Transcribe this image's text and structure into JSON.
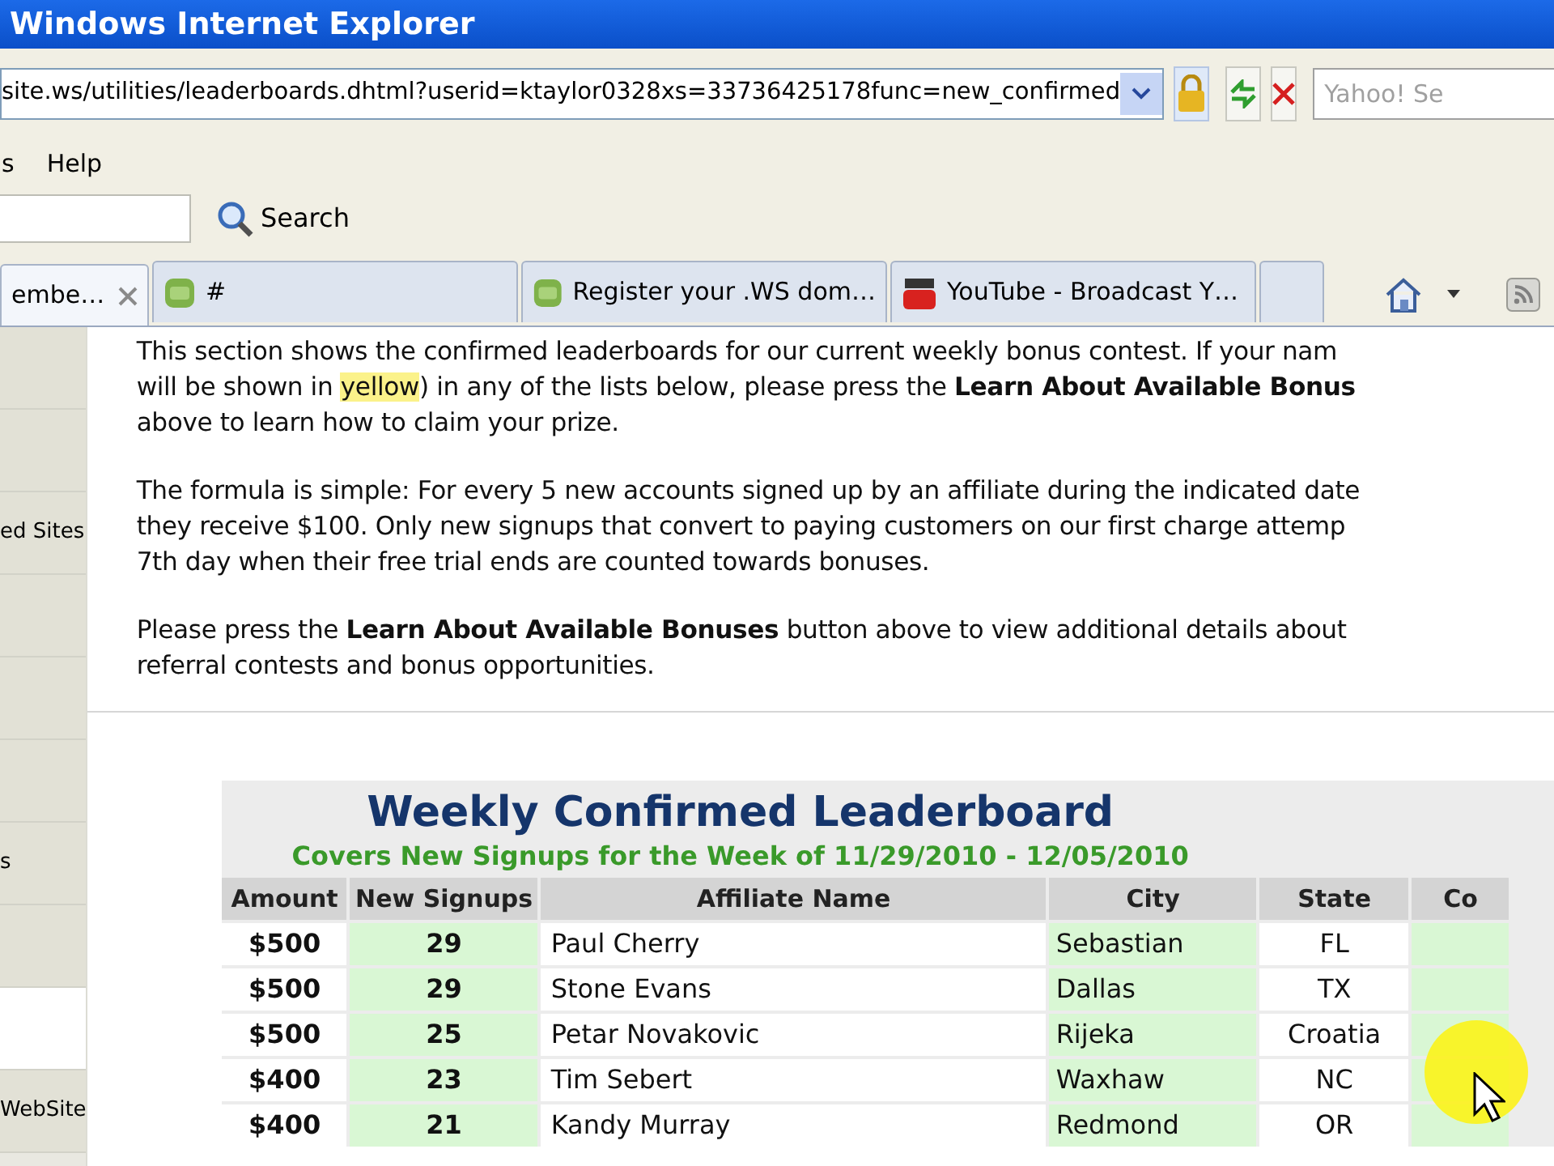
{
  "window": {
    "title": "Windows Internet Explorer"
  },
  "address_bar": {
    "url": "site.ws/utilities/leaderboards.dhtml?userid=ktaylor0328xs=33736425178func=new_confirmed"
  },
  "search_box": {
    "placeholder": "Yahoo! Se"
  },
  "menu": [
    "s",
    "Help"
  ],
  "toolbar": {
    "search_button": "Search"
  },
  "tabs": [
    {
      "label": "embe…",
      "selected": true,
      "kind": "plain"
    },
    {
      "label": "#",
      "selected": false,
      "kind": "site"
    },
    {
      "label": "Register your .WS dom…",
      "selected": false,
      "kind": "site"
    },
    {
      "label": "YouTube - Broadcast Y…",
      "selected": false,
      "kind": "video"
    },
    {
      "selected": false,
      "kind": "plain"
    }
  ],
  "sidebar": {
    "items": [
      {
        "selected": false
      },
      {
        "selected": false
      },
      {
        "label": "ed Sites",
        "selected": false
      },
      {
        "selected": false
      },
      {
        "selected": false
      },
      {
        "selected": false
      },
      {
        "label": "s",
        "selected": false
      },
      {
        "selected": false
      },
      {
        "selected": true
      },
      {
        "label": "WebSite",
        "selected": false
      }
    ]
  },
  "intro": {
    "paragraphs": [
      [
        [
          {
            "kind": "plain",
            "text": "This section shows the confirmed leaderboards for our current weekly bonus contest. If your nam"
          }
        ],
        [
          {
            "kind": "plain",
            "text": "will be shown in "
          },
          {
            "kind": "highlight",
            "text": "yellow"
          },
          {
            "kind": "plain",
            "text": ") in any of the lists below, please press the "
          },
          {
            "kind": "bold",
            "text": "Learn About Available Bonus"
          }
        ],
        [
          {
            "kind": "plain",
            "text": "above to learn how to claim your prize."
          }
        ]
      ],
      [
        [
          {
            "kind": "plain",
            "text": "The formula is simple: For every 5 new accounts signed up by an affiliate during the indicated date"
          }
        ],
        [
          {
            "kind": "plain",
            "text": "they receive $100. Only new signups that convert to paying customers on our first charge attemp"
          }
        ],
        [
          {
            "kind": "plain",
            "text": "7th day when their free trial ends are counted towards bonuses."
          }
        ]
      ],
      [
        [
          {
            "kind": "plain",
            "text": "Please press the "
          },
          {
            "kind": "bold",
            "text": "Learn About Available Bonuses"
          },
          {
            "kind": "plain",
            "text": " button above to view additional details about"
          }
        ],
        [
          {
            "kind": "plain",
            "text": "referral contests and bonus opportunities."
          }
        ]
      ]
    ]
  },
  "leaderboard": {
    "title": "Weekly Confirmed Leaderboard",
    "subtitle": "Covers New Signups for the Week of 11/29/2010 - 12/05/2010",
    "columns": [
      "Amount",
      "New Signups",
      "Affiliate Name",
      "City",
      "State",
      "Co"
    ],
    "rows": [
      [
        "$500",
        "29",
        "Paul Cherry",
        "Sebastian",
        "FL"
      ],
      [
        "$500",
        "29",
        "Stone Evans",
        "Dallas",
        "TX"
      ],
      [
        "$500",
        "25",
        "Petar Novakovic",
        "Rijeka",
        "Croatia"
      ],
      [
        "$400",
        "23",
        "Tim Sebert",
        "Waxhaw",
        "NC"
      ],
      [
        "$400",
        "21",
        "Kandy Murray",
        "Redmond",
        "OR"
      ]
    ]
  }
}
